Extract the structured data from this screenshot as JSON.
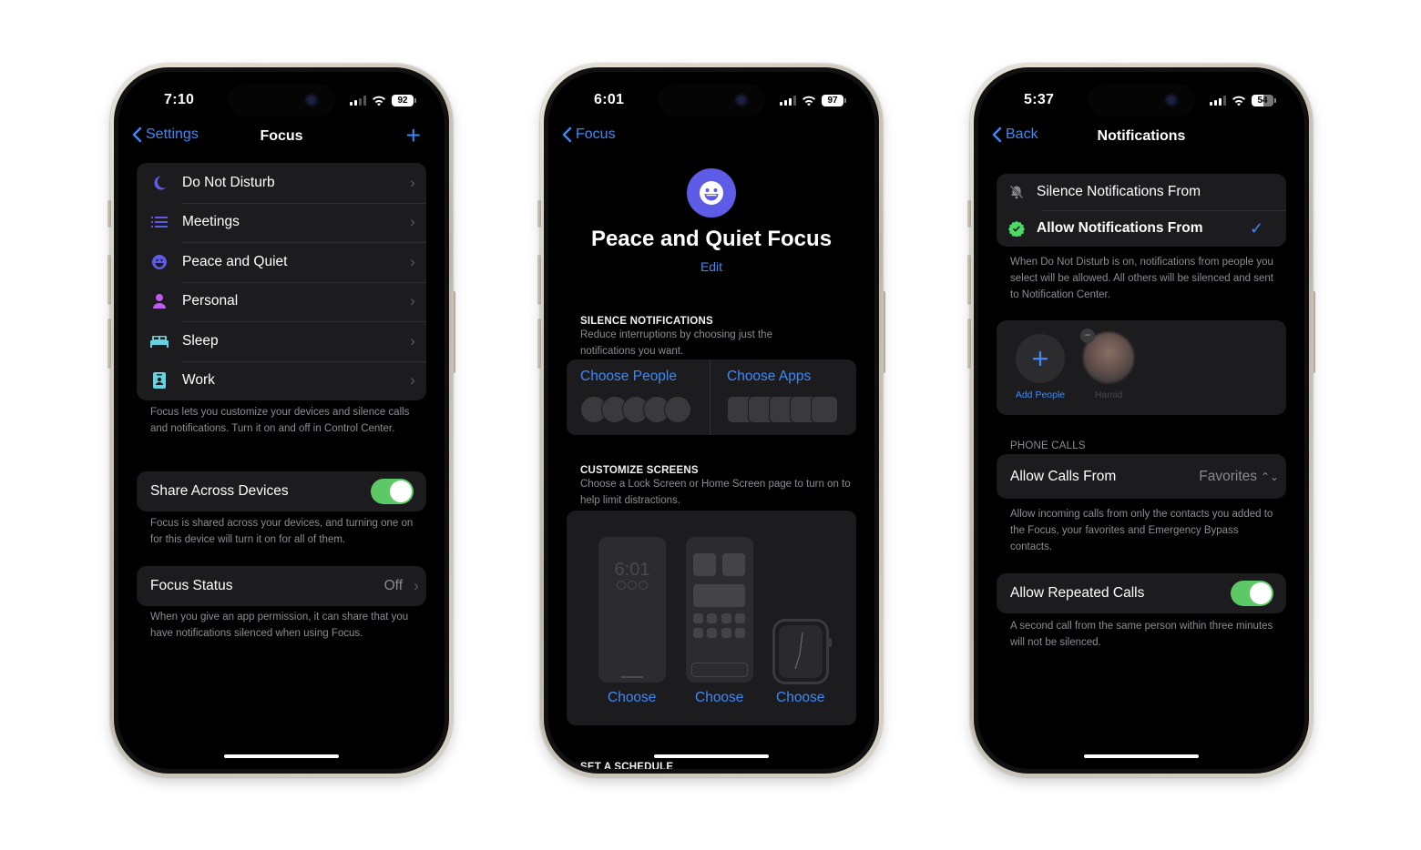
{
  "phones": [
    {
      "status": {
        "time": "7:10",
        "battery": "92",
        "signal_bars": 2
      },
      "nav": {
        "back_label": "Settings",
        "title": "Focus",
        "add_icon": "plus-icon"
      },
      "focus_list": [
        {
          "label": "Do Not Disturb",
          "icon": "moon-icon",
          "color": "#5e5ce6"
        },
        {
          "label": "Meetings",
          "icon": "list-icon",
          "color": "#5e5ce6"
        },
        {
          "label": "Peace and Quiet",
          "icon": "smiley-icon",
          "color": "#5e5ce6"
        },
        {
          "label": "Personal",
          "icon": "person-icon",
          "color": "#bf5af2"
        },
        {
          "label": "Sleep",
          "icon": "bed-icon",
          "color": "#64d2e0"
        },
        {
          "label": "Work",
          "icon": "id-badge-icon",
          "color": "#64d2e0"
        }
      ],
      "focus_list_footnote": "Focus lets you customize your devices and silence calls and notifications. Turn it on and off in Control Center.",
      "share_across_devices": {
        "label": "Share Across Devices",
        "enabled": true
      },
      "share_footnote": "Focus is shared across your devices, and turning one on for this device will turn it on for all of them.",
      "focus_status": {
        "label": "Focus Status",
        "value": "Off"
      },
      "focus_status_footnote": "When you give an app permission, it can share that you have notifications silenced when using Focus."
    },
    {
      "status": {
        "time": "6:01",
        "battery": "97",
        "signal_bars": 3
      },
      "nav": {
        "back_label": "Focus"
      },
      "focus_icon": "smiley-icon",
      "title": "Peace and Quiet Focus",
      "edit_label": "Edit",
      "silence_section": {
        "heading": "SILENCE NOTIFICATIONS",
        "description": "Reduce interruptions by choosing just the notifications you want.",
        "choose_people": "Choose People",
        "choose_apps": "Choose Apps"
      },
      "customize_section": {
        "heading": "CUSTOMIZE SCREENS",
        "description": "Choose a Lock Screen or Home Screen page to turn on to help limit distractions.",
        "lock_screen_time": "6:01",
        "choose_labels": [
          "Choose",
          "Choose",
          "Choose"
        ]
      },
      "schedule_heading": "SET A SCHEDULE"
    },
    {
      "status": {
        "time": "5:37",
        "battery": "54",
        "signal_bars": 3
      },
      "nav": {
        "back_label": "Back",
        "title": "Notifications"
      },
      "mode_options": [
        {
          "label": "Silence Notifications From",
          "icon": "bell-slash-icon",
          "selected": false
        },
        {
          "label": "Allow Notifications From",
          "icon": "checkmark-seal-icon",
          "selected": true
        }
      ],
      "mode_footnote": "When Do Not Disturb is on, notifications from people you select will be allowed. All others will be silenced and sent to Notification Center.",
      "people": {
        "add_label": "Add People",
        "contacts": [
          {
            "name": "Hamid"
          }
        ]
      },
      "phone_calls": {
        "heading": "PHONE CALLS",
        "allow_calls_from": {
          "label": "Allow Calls From",
          "value": "Favorites"
        },
        "calls_footnote": "Allow incoming calls from only the contacts you added to the Focus, your favorites and Emergency Bypass contacts.",
        "repeated_calls": {
          "label": "Allow Repeated Calls",
          "enabled": true
        },
        "repeated_footnote": "A second call from the same person within three minutes will not be silenced."
      }
    }
  ],
  "colors": {
    "accent": "#3d8af7",
    "toggle_on": "#5dc866",
    "focus_purple": "#5e5ce6",
    "cell_bg": "#1c1c1e"
  }
}
